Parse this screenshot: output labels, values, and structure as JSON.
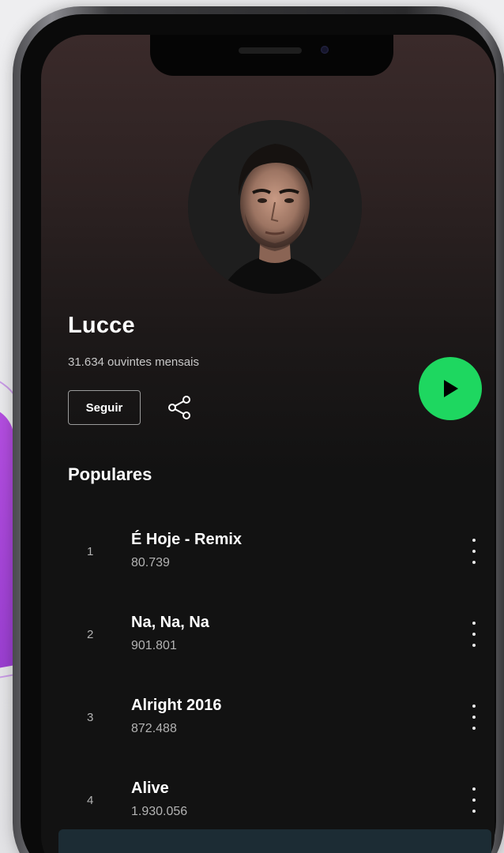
{
  "artist": {
    "name": "Lucce",
    "monthly_listeners": "31.634 ouvintes mensais"
  },
  "actions": {
    "follow_label": "Seguir",
    "share_icon": "share-icon",
    "play_icon": "play-icon"
  },
  "popular": {
    "title": "Populares",
    "tracks": [
      {
        "number": "1",
        "title": "É Hoje - Remix",
        "plays": "80.739"
      },
      {
        "number": "2",
        "title": "Na, Na, Na",
        "plays": "901.801"
      },
      {
        "number": "3",
        "title": "Alright 2016",
        "plays": "872.488"
      },
      {
        "number": "4",
        "title": "Alive",
        "plays": "1.930.056"
      }
    ]
  },
  "colors": {
    "accent": "#1ed760",
    "background": "#121212",
    "header_tint": "#3a2a2a",
    "secondary_text": "#b3b3b3"
  }
}
